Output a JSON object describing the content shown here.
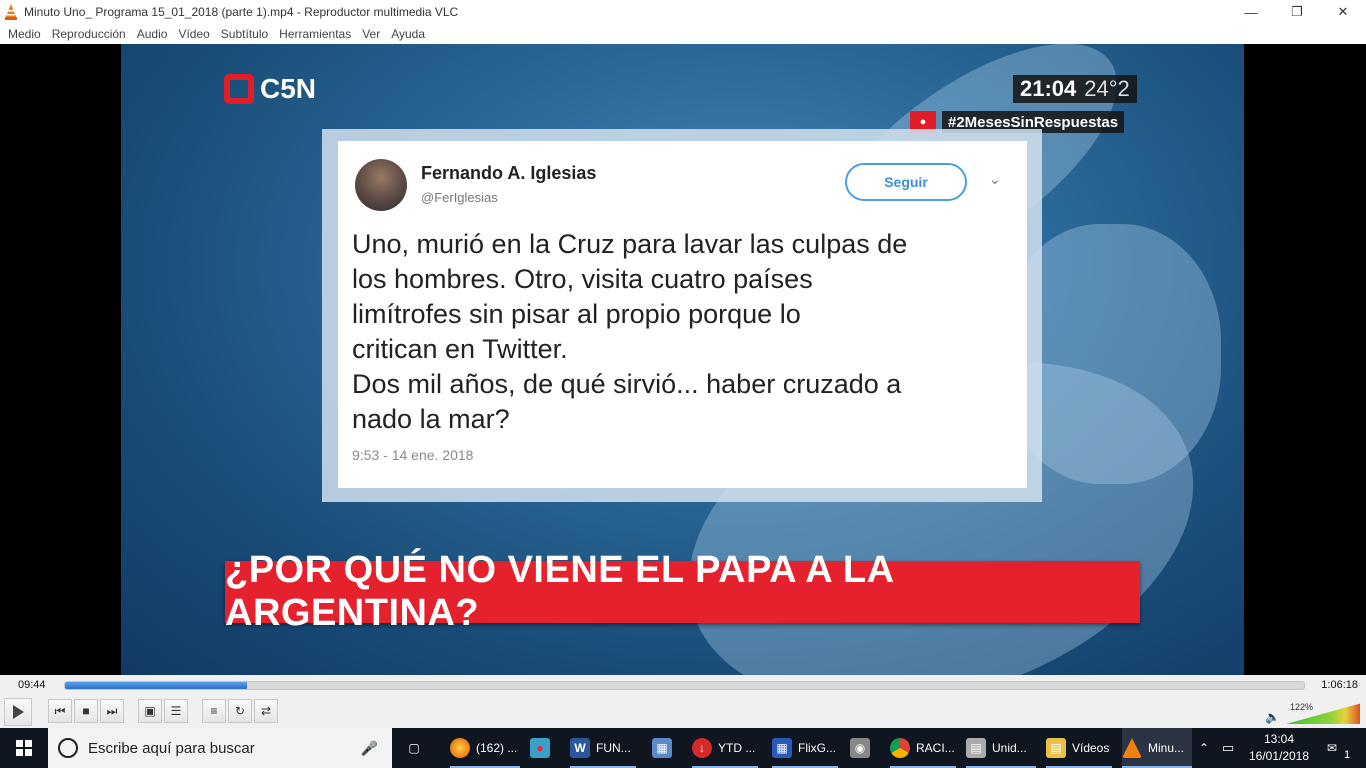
{
  "window": {
    "title": "Minuto Uno_ Programa 15_01_2018 (parte 1).mp4 - Reproductor multimedia VLC",
    "minimize": "—",
    "restore": "❐",
    "close": "✕"
  },
  "menu": [
    "Medio",
    "Reproducción",
    "Audio",
    "Vídeo",
    "Subtítulo",
    "Herramientas",
    "Ver",
    "Ayuda"
  ],
  "video": {
    "channel_logo": "C5N",
    "clock": "21:04",
    "temperature": "24°2",
    "hashtag": "#2MesesSinRespuestas",
    "tweet": {
      "author": "Fernando A. Iglesias",
      "handle": "@FerIglesias",
      "follow_label": "Seguir",
      "text": "Uno, murió en la Cruz para lavar las culpas de\nlos hombres. Otro, visita cuatro países\nlimítrofes sin pisar al propio porque lo\ncritican en Twitter.\nDos mil años, de qué sirvió... haber cruzado a\nnado la mar?",
      "date": "9:53 - 14 ene. 2018"
    },
    "banner": "¿POR QUÉ NO VIENE EL PAPA A LA ARGENTINA?"
  },
  "player": {
    "elapsed": "09:44",
    "total": "1:06:18",
    "progress": 0.147,
    "volume_label": "122%",
    "volume": 1.22
  },
  "taskbar": {
    "search_placeholder": "Escribe aquí para buscar",
    "apps": [
      {
        "icon": "firefox-icon",
        "label": "(162) ..."
      },
      {
        "icon": "screen-recorder-icon",
        "label": ""
      },
      {
        "icon": "word-icon",
        "label": "FUN..."
      },
      {
        "icon": "computer-icon",
        "label": ""
      },
      {
        "icon": "ytd-icon",
        "label": "YTD ..."
      },
      {
        "icon": "flixgrab-icon",
        "label": "FlixG..."
      },
      {
        "icon": "camera-icon",
        "label": ""
      },
      {
        "icon": "chrome-icon",
        "label": "RACI..."
      },
      {
        "icon": "drive-icon",
        "label": "Unid..."
      },
      {
        "icon": "folder-icon",
        "label": "Vídeos"
      },
      {
        "icon": "vlc-icon",
        "label": "Minu..."
      }
    ],
    "time": "13:04",
    "date": "16/01/2018",
    "notification_count": "1"
  }
}
